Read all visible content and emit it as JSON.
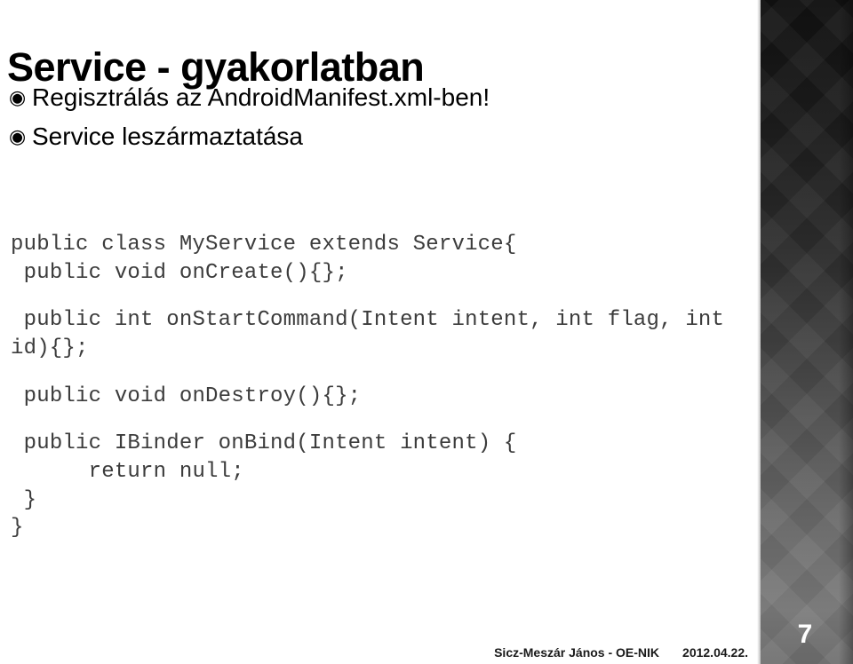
{
  "slide": {
    "title": "Service - gyakorlatban",
    "page_number": "7"
  },
  "bullets": [
    {
      "glyph": "◉",
      "text": "Regisztrálás az AndroidManifest.xml-ben!"
    },
    {
      "glyph": "◉",
      "text": "Service leszármaztatása"
    }
  ],
  "code": {
    "lines": [
      "public class MyService extends Service{",
      " public void onCreate(){};",
      "",
      " public int onStartCommand(Intent intent, int flag, int id){};",
      "",
      " public void onDestroy(){};",
      "",
      " public IBinder onBind(Intent intent) {",
      "      return null;",
      " }",
      "}"
    ]
  },
  "footer": {
    "author": "Sicz-Meszár János - OE-NIK",
    "date": "2012.04.22."
  },
  "colors": {
    "title": "#000000",
    "code_text": "#3c3c3c",
    "sidebar_top": "#121212",
    "sidebar_bottom": "#7b7b7b",
    "page_number": "#ffffff"
  }
}
